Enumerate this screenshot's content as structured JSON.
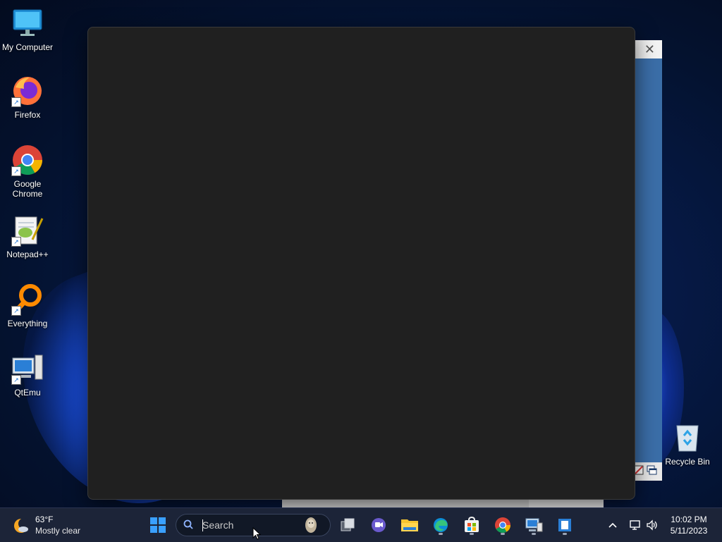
{
  "desktop": {
    "icons": [
      {
        "label": "My Computer"
      },
      {
        "label": "Firefox"
      },
      {
        "label": "Google Chrome"
      },
      {
        "label": "Notepad++"
      },
      {
        "label": "Everything"
      },
      {
        "label": "QtEmu"
      },
      {
        "label": "Recycle Bin"
      }
    ]
  },
  "background_window": {
    "close_glyph": "✕"
  },
  "taskbar": {
    "weather": {
      "temp": "63°F",
      "condition": "Mostly clear"
    },
    "search": {
      "placeholder": "Search"
    },
    "pinned": [
      "task-view-icon",
      "teams-chat-icon",
      "file-explorer-icon",
      "edge-icon",
      "microsoft-store-icon",
      "chrome-icon",
      "remote-desktop-icon",
      "notepad-app-icon"
    ],
    "clock": {
      "time": "10:02 PM",
      "date": "5/11/2023"
    }
  },
  "colors": {
    "desktop_bg": "#061a48",
    "window_bg": "#202020",
    "taskbar_bg": "#1c2438",
    "accent_blue": "#3b6ea8"
  }
}
